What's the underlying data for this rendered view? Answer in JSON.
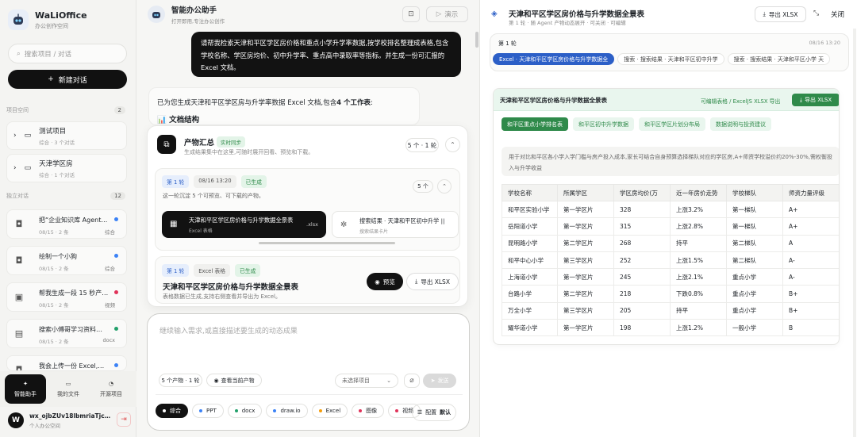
{
  "sidebar": {
    "brand": {
      "name": "WaLiOffice",
      "sub": "办公创作空间"
    },
    "search_placeholder": "搜索项目 / 对话",
    "new_chat": "新建对话",
    "projects_title": "项目空间",
    "projects_count": "2",
    "projects": [
      {
        "title": "测试项目",
        "meta": "综合 · 3 个对话"
      },
      {
        "title": "天津学区房",
        "meta": "综合 · 1 个对话"
      }
    ],
    "chats_title": "独立对话",
    "chats_count": "12",
    "chats": [
      {
        "title": "把“企业知识库 Agent…",
        "date": "08/15",
        "count": "2 条",
        "tag": "综合",
        "dot": "#3b82f6"
      },
      {
        "title": "绘制一个小狗",
        "date": "08/15",
        "count": "2 条",
        "tag": "综合",
        "dot": "#3b82f6"
      },
      {
        "title": "帮我生成一段 15 秒产…",
        "date": "08/15",
        "count": "2 条",
        "tag": "视频",
        "dot": "#e0335a"
      },
      {
        "title": "搜索小傅哥学习资料…",
        "date": "08/15",
        "count": "2 条",
        "tag": "docx",
        "dot": "#22a06b"
      },
      {
        "title": "我会上传一份 Excel,…",
        "date": "",
        "count": "",
        "tag": "",
        "dot": "#3b82f6"
      }
    ],
    "nav": [
      {
        "label": "智能助手"
      },
      {
        "label": "我的文件"
      },
      {
        "label": "开源项目"
      }
    ],
    "user": {
      "initial": "W",
      "name": "wx_ojbZUv18lbmriaTjc…",
      "org": "个人办公空间"
    }
  },
  "assistant": {
    "title": "智能办公助手",
    "subtitle": "打开即用,专注办公创作",
    "demo": "演示",
    "user_message": "请帮我检索天津和平区学区房价格和重点小学升学率数据,按学校排名整理成表格,包含学校名称、学区房均价、初中升学率、重点高中录取率等指标。并生成一份可汇报的 Excel 文档。",
    "reply": "已为您生成天津和平区学区房与升学率数据 Excel 文档,包含",
    "reply_bold": "4 个工作表",
    "reply_tail": ":",
    "reply_h2": "📊 文档结构"
  },
  "artifacts": {
    "title": "产物汇总",
    "badge": "实时同步",
    "subtitle": "生成结果集中在这里,可随时展开回看、预览和下载。",
    "count": "5 个 · 1 轮",
    "round1": {
      "round": "第 1 轮",
      "time": "08/16 13:20",
      "status": "已生成",
      "desc": "这一轮沉淀 5 个可预览、可下载的产物。",
      "count": "5 个",
      "file1": {
        "title": "天津和平区学区房价格与升学数据全景表",
        "sub": "Excel 表格",
        "ext": ".xlsx"
      },
      "file2": {
        "title": "搜索结果 · 天津和平区初中升学 ||",
        "sub": "搜索结果卡片"
      }
    },
    "round2": {
      "round": "第 1 轮",
      "type": "Excel 表格",
      "status": "已生成",
      "title": "天津和平区学区房价格与升学数据全景表",
      "desc": "表格数据已生成,支持右侧查看并导出为 Excel。",
      "preview": "预览",
      "export": "导出 XLSX"
    }
  },
  "composer": {
    "placeholder": "继续输入需求,或直接描述要生成的动态成果",
    "products": "5 个产物 · 1 轮",
    "view": "查看当前产物",
    "project_select": "未选择项目",
    "send": "发送",
    "chips": [
      {
        "label": "综合",
        "dot": "#ffffff"
      },
      {
        "label": "PPT",
        "dot": "#3b82f6"
      },
      {
        "label": "docx",
        "dot": "#22a06b"
      },
      {
        "label": "draw.io",
        "dot": "#3b82f6"
      },
      {
        "label": "Excel",
        "dot": "#f59e0b"
      },
      {
        "label": "图像",
        "dot": "#e0335a"
      },
      {
        "label": "视频",
        "dot": "#e0335a"
      }
    ],
    "config": "配置",
    "config_value": "默认"
  },
  "right": {
    "title": "天津和平区学区房价格与升学数据全景表",
    "subtitle": "第 1 轮 · 随 Agent 产物动态展开 · 可关闭 · 可编辑",
    "export": "导出 XLSX",
    "close": "关闭",
    "round": "第 1 轮",
    "time": "08/16 13:20",
    "tabs": [
      "Excel · 天津和平区学区房价格与升学数据全",
      "搜索 · 搜索结果 · 天津和平区初中升学",
      "搜索 · 搜索结果 · 天津和平区小学 天"
    ],
    "sheet": {
      "title": "天津和平区学区房价格与升学数据全景表",
      "info": "可编辑表格 / ExcelJS XLSX 导出",
      "export": "导出 XLSX",
      "tabs": [
        "和平区重点小学排名表",
        "和平区初中升学数据",
        "和平区学区片划分布局",
        "数据说明与投资建议"
      ],
      "note": "用于对比和平区各小学入学门槛与房产投入成本,家长可结合自身预算选择梯队对应的学区房,A+师资学校溢价约20%-30%,需权衡投入与升学收益",
      "columns": [
        "学校名称",
        "所属学区",
        "学区房均价(万",
        "近一年房价走势",
        "学校梯队",
        "师资力量评级"
      ],
      "rows": [
        [
          "和平区实验小学",
          "第一学区片",
          "328",
          "上涨3.2%",
          "第一梯队",
          "A+"
        ],
        [
          "岳阳道小学",
          "第一学区片",
          "315",
          "上涨2.8%",
          "第一梯队",
          "A+"
        ],
        [
          "昆明路小学",
          "第二学区片",
          "268",
          "持平",
          "第二梯队",
          "A"
        ],
        [
          "和平中心小学",
          "第三学区片",
          "252",
          "上涨1.5%",
          "第二梯队",
          "A-"
        ],
        [
          "上海道小学",
          "第一学区片",
          "245",
          "上涨2.1%",
          "重点小学",
          "A-"
        ],
        [
          "台路小学",
          "第二学区片",
          "218",
          "下跌0.8%",
          "重点小学",
          "B+"
        ],
        [
          "万全小学",
          "第三学区片",
          "205",
          "持平",
          "重点小学",
          "B+"
        ],
        [
          "耀华道小学",
          "第一学区片",
          "198",
          "上涨1.2%",
          "一般小学",
          "B"
        ]
      ]
    }
  }
}
